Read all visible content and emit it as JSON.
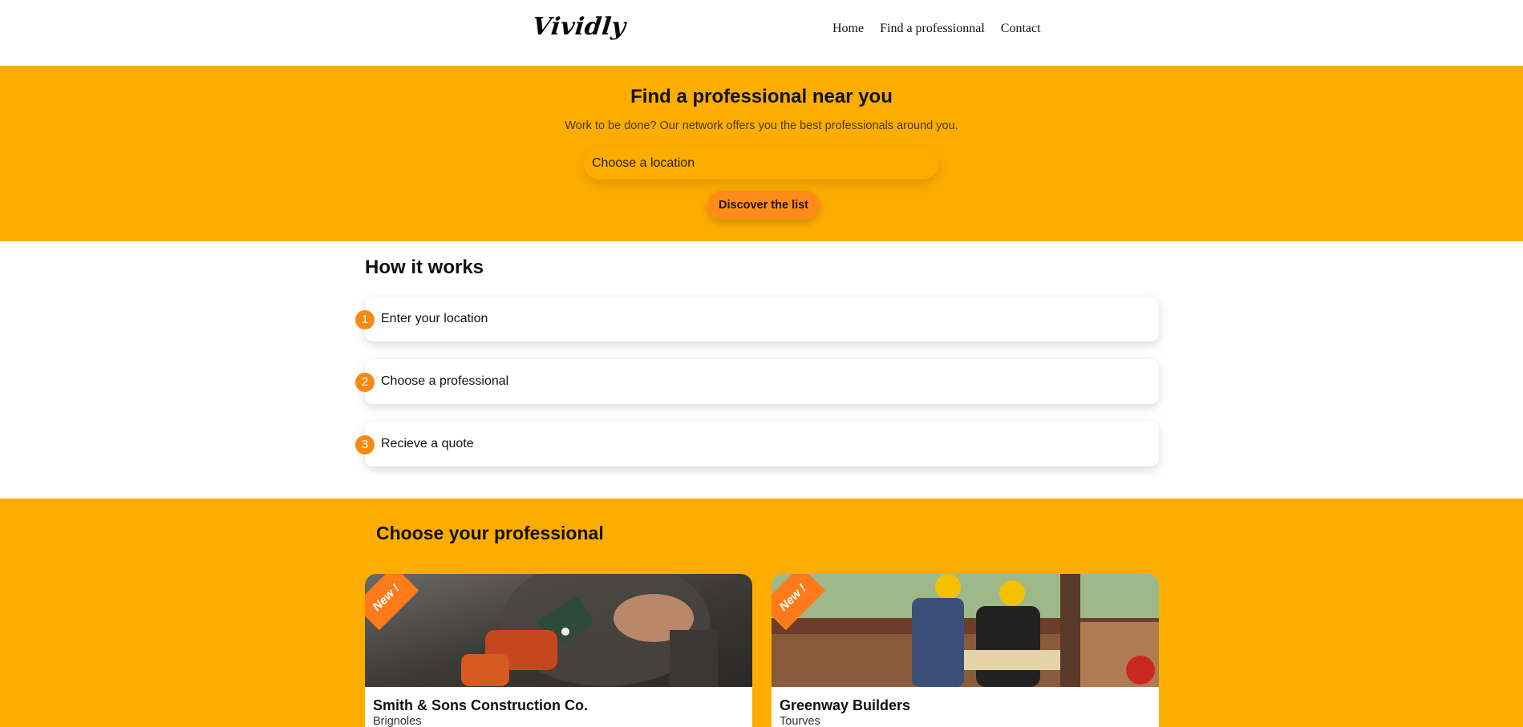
{
  "header": {
    "logo": "Vividly",
    "nav": [
      "Home",
      "Find a professionnal",
      "Contact"
    ]
  },
  "hero": {
    "title": "Find a professional near you",
    "subtitle": "Work to be done? Our network offers you the best professionals around you.",
    "location_placeholder": "Choose a location",
    "cta_label": "Discover the list"
  },
  "how_it_works": {
    "title": "How it works",
    "steps": [
      {
        "number": "1",
        "label": "Enter your location"
      },
      {
        "number": "2",
        "label": "Choose a professional"
      },
      {
        "number": "3",
        "label": "Recieve a quote"
      }
    ]
  },
  "professionals": {
    "title": "Choose your professional",
    "cards": [
      {
        "badge": "New !",
        "name": "Smith & Sons Construction Co.",
        "city": "Brignoles"
      },
      {
        "badge": "New !",
        "name": "Greenway Builders",
        "city": "Tourves"
      }
    ]
  },
  "colors": {
    "accent": "#fdad00",
    "button": "#ff8c1a",
    "step_badge": "#f58a12",
    "ribbon": "#ff7a1a"
  }
}
